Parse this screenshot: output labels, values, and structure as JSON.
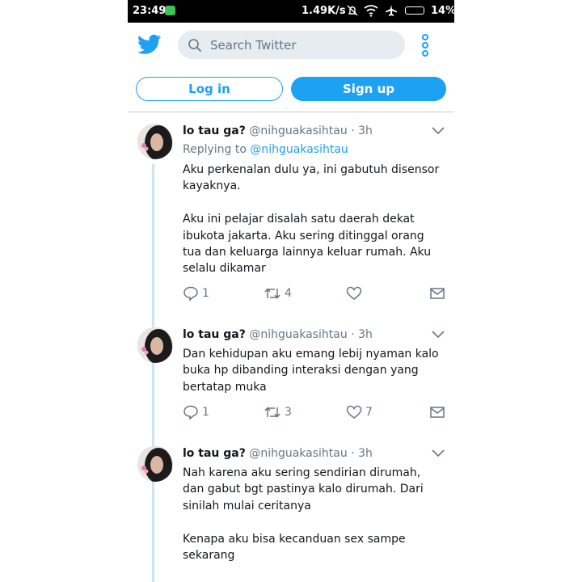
{
  "status_bar": {
    "time": "23:49",
    "speed": "1.49K/s",
    "battery": "14%"
  },
  "header": {
    "search_placeholder": "Search Twitter"
  },
  "auth": {
    "login": "Log in",
    "signup": "Sign up"
  },
  "tweets": [
    {
      "name": "lo tau ga?",
      "handle": "@nihguakasihtau",
      "time": "· 3h",
      "replying_label": "Replying to",
      "replying_to": "@nihguakasihtau",
      "paragraphs": [
        "Aku perkenalan dulu ya, ini gabutuh disensor kayaknya.",
        "Aku ini pelajar disalah satu daerah dekat ibukota jakarta. Aku sering ditinggal orang tua dan keluarga lainnya keluar rumah. Aku selalu dikamar"
      ],
      "replies": "1",
      "retweets": "4",
      "likes": ""
    },
    {
      "name": "lo tau ga?",
      "handle": "@nihguakasihtau",
      "time": "· 3h",
      "paragraphs": [
        "Dan kehidupan aku emang lebij nyaman kalo buka hp dibanding interaksi dengan yang bertatap muka"
      ],
      "replies": "1",
      "retweets": "3",
      "likes": "7"
    },
    {
      "name": "lo tau ga?",
      "handle": "@nihguakasihtau",
      "time": "· 3h",
      "paragraphs": [
        "Nah karena aku sering sendirian dirumah, dan gabut bgt pastinya kalo dirumah. Dari sinilah mulai ceritanya",
        "Kenapa aku bisa kecanduan sex sampe sekarang"
      ]
    }
  ]
}
